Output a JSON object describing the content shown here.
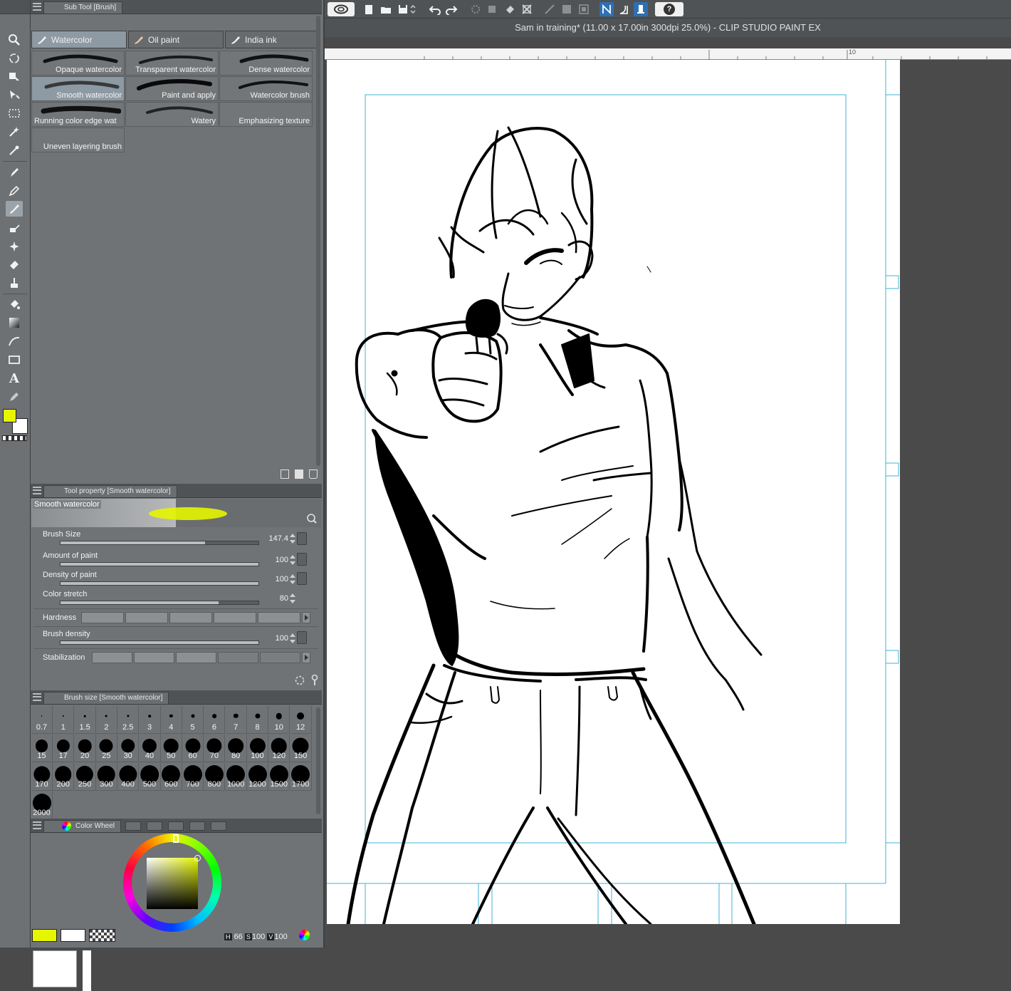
{
  "app": {
    "window_title": "Sam in training* (11.00 x 17.00in 300dpi 25.0%)  - CLIP STUDIO PAINT EX"
  },
  "ruler": {
    "mark": "10"
  },
  "subtool_panel": {
    "title": "Sub Tool [Brush]",
    "groups": [
      {
        "label": "Watercolor",
        "selected": true
      },
      {
        "label": "Oil paint",
        "selected": false
      },
      {
        "label": "India ink",
        "selected": false
      }
    ],
    "brushes": [
      {
        "label": "Opaque watercolor"
      },
      {
        "label": "Transparent watercolor"
      },
      {
        "label": "Dense watercolor"
      },
      {
        "label": "Smooth watercolor",
        "selected": true
      },
      {
        "label": "Paint and apply"
      },
      {
        "label": "Watercolor brush"
      },
      {
        "label": "Running color edge wat"
      },
      {
        "label": "Watery"
      },
      {
        "label": "Emphasizing texture"
      },
      {
        "label": "Uneven layering brush"
      }
    ]
  },
  "tool_property": {
    "title": "Tool property [Smooth watercolor]",
    "preset_name": "Smooth watercolor",
    "brush_size": {
      "label": "Brush Size",
      "value": "147.4",
      "fraction": 0.73
    },
    "amount_of_paint": {
      "label": "Amount of paint",
      "value": "100",
      "fraction": 1.0
    },
    "density_of_paint": {
      "label": "Density of paint",
      "value": "100",
      "fraction": 1.0
    },
    "color_stretch": {
      "label": "Color stretch",
      "value": "80",
      "fraction": 0.8
    },
    "hardness": {
      "label": "Hardness",
      "level": 5
    },
    "brush_density": {
      "label": "Brush density",
      "value": "100",
      "fraction": 1.0
    },
    "stabilization": {
      "label": "Stabilization",
      "level": 3
    }
  },
  "brush_size_panel": {
    "title": "Brush size [Smooth watercolor]",
    "sizes": [
      "0.7",
      "1",
      "1.5",
      "2",
      "2.5",
      "3",
      "4",
      "5",
      "6",
      "7",
      "8",
      "10",
      "12",
      "15",
      "17",
      "20",
      "25",
      "30",
      "40",
      "50",
      "60",
      "70",
      "80",
      "100",
      "120",
      "150",
      "170",
      "200",
      "250",
      "300",
      "400",
      "500",
      "600",
      "700",
      "800",
      "1000",
      "1200",
      "1500",
      "1700",
      "2000"
    ]
  },
  "color_panel": {
    "title": "Color Wheel",
    "main_color": "#e6f500",
    "sub_color": "#ffffff",
    "hsv": {
      "h_label": "H",
      "h": "66",
      "s_label": "S",
      "s": "100",
      "v_label": "V",
      "v": "100"
    }
  },
  "colors": {
    "accent_selected": "#8e9aa3",
    "guide_line": "#3fb3d8"
  }
}
